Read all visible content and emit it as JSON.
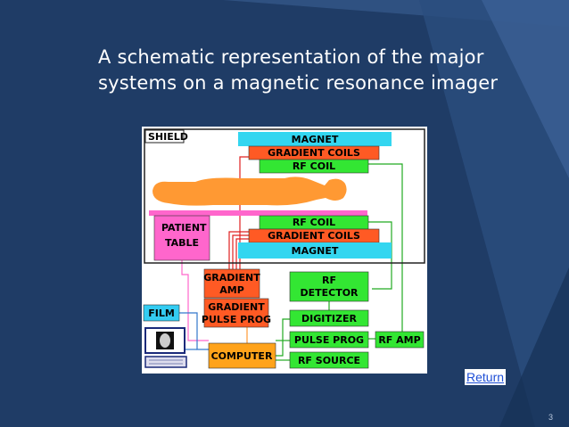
{
  "slide": {
    "title_line1": "A schematic representation of the major",
    "title_line2": "systems on a magnetic resonance imager",
    "return_link": "Return",
    "page_number": "3"
  },
  "diagram": {
    "shield": "SHIELD",
    "magnet_top": "MAGNET",
    "gradient_coils_top": "GRADIENT COILS",
    "rf_coil_top": "RF COIL",
    "patient_table_line1": "PATIENT",
    "patient_table_line2": "TABLE",
    "rf_coil_bottom": "RF COIL",
    "gradient_coils_bottom": "GRADIENT COILS",
    "magnet_bottom": "MAGNET",
    "gradient_amp_line1": "GRADIENT",
    "gradient_amp_line2": "AMP",
    "gradient_pulse_line1": "GRADIENT",
    "gradient_pulse_line2": "PULSE PROG",
    "rf_detector_line1": "RF",
    "rf_detector_line2": "DETECTOR",
    "digitizer": "DIGITIZER",
    "pulse_prog": "PULSE PROG",
    "rf_amp": "RF AMP",
    "rf_source": "RF SOURCE",
    "computer": "COMPUTER",
    "film": "FILM",
    "colors": {
      "magnet": "#33d6f0",
      "gradient": "#ff5a24",
      "rf": "#33e633",
      "table": "#ff66cc",
      "computer": "#ffa31a",
      "film": "#33ccf2",
      "patient": "#ff9933"
    }
  }
}
